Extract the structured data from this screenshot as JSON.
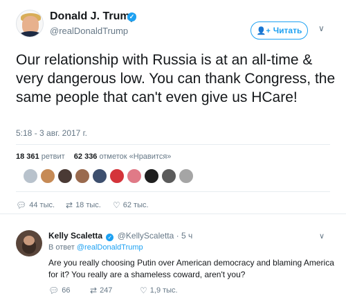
{
  "tweet": {
    "display_name": "Donald J. Trump",
    "handle": "@realDonaldTrump",
    "follow_label": "Читать",
    "follow_icon": "add-person-icon",
    "text": "Our relationship with Russia is at an all-time & very dangerous  low. You can thank Congress, the same people that can't even give us HCare!",
    "timestamp": "5:18 - 3 авг. 2017 г.",
    "retweets_count": "18 361",
    "retweets_label": "ретвит",
    "likes_count": "62 336",
    "likes_label": "отметок «Нравится»",
    "actions": {
      "reply": "44 тыс.",
      "retweet": "18 тыс.",
      "like": "62 тыс."
    },
    "liker_colors": [
      "#b8c2cc",
      "#c68a55",
      "#4a3a35",
      "#9a6a4e",
      "#3d4f6e",
      "#d4343a",
      "#e07a87",
      "#1f1f1f",
      "#5b5b5b",
      "#a5a5a5"
    ]
  },
  "reply": {
    "display_name": "Kelly Scaletta",
    "handle": "@KellyScaletta",
    "time": "· 5 ч",
    "reply_to_prefix": "В ответ",
    "reply_to_handle": "@realDonaldTrump",
    "text": "Are you really choosing Putin over American democracy and blaming America for it? You really are a shameless coward, aren't you?",
    "actions": {
      "reply": "66",
      "retweet": "247",
      "like": "1,9 тыс."
    }
  },
  "colors": {
    "accent": "#1da1f2",
    "secondary_text": "#657786",
    "primary_text": "#14171a"
  }
}
